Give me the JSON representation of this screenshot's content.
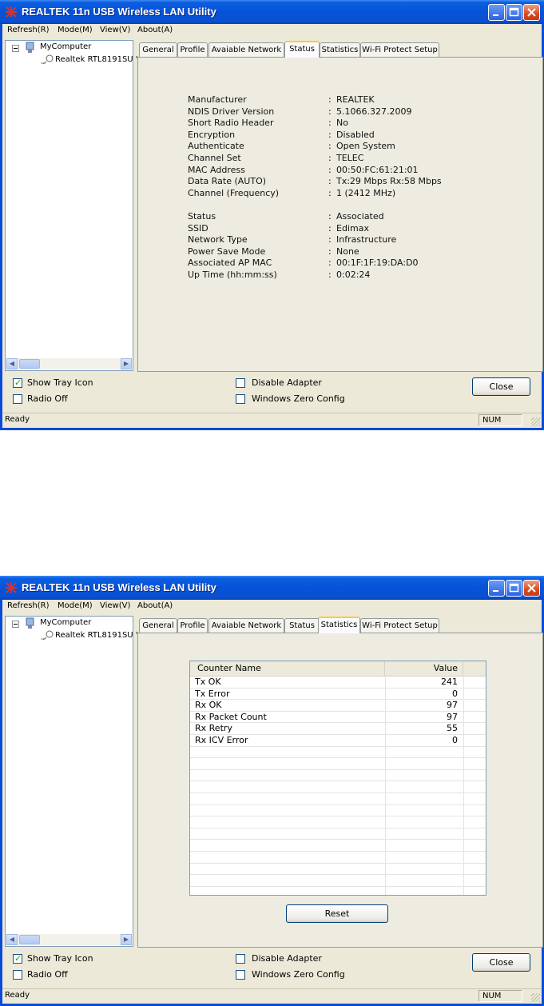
{
  "window1": {
    "title": "REALTEK 11n USB Wireless LAN Utility",
    "menu": [
      "Refresh(R)",
      "Mode(M)",
      "View(V)",
      "About(A)"
    ],
    "tree": {
      "root": "MyComputer",
      "child": "Realtek RTL8191SU '"
    },
    "tabs": [
      "General",
      "Profile",
      "Avaiable Network",
      "Status",
      "Statistics",
      "Wi-Fi Protect Setup"
    ],
    "active_tab": "Status",
    "status_fields": [
      {
        "label": "Manufacturer",
        "value": "REALTEK"
      },
      {
        "label": "NDIS Driver Version",
        "value": "5.1066.327.2009"
      },
      {
        "label": "Short Radio Header",
        "value": "No"
      },
      {
        "label": "Encryption",
        "value": "Disabled"
      },
      {
        "label": "Authenticate",
        "value": "Open System"
      },
      {
        "label": "Channel Set",
        "value": "TELEC"
      },
      {
        "label": "MAC Address",
        "value": "00:50:FC:61:21:01"
      },
      {
        "label": "Data Rate (AUTO)",
        "value": "Tx:29 Mbps Rx:58 Mbps"
      },
      {
        "label": "Channel (Frequency)",
        "value": "1 (2412 MHz)"
      },
      {
        "label": "Status",
        "value": "Associated"
      },
      {
        "label": "SSID",
        "value": "Edimax"
      },
      {
        "label": "Network Type",
        "value": "Infrastructure"
      },
      {
        "label": "Power Save Mode",
        "value": "None"
      },
      {
        "label": "Associated AP MAC",
        "value": "00:1F:1F:19:DA:D0"
      },
      {
        "label": "Up Time (hh:mm:ss)",
        "value": "0:02:24"
      }
    ],
    "separator": ":",
    "bottom": {
      "show_tray_icon": {
        "label": "Show Tray Icon",
        "checked": true
      },
      "radio_off": {
        "label": "Radio Off",
        "checked": false
      },
      "disable_adapter": {
        "label": "Disable Adapter",
        "checked": false
      },
      "windows_zero_config": {
        "label": "Windows Zero Config",
        "checked": false
      },
      "close_label": "Close"
    },
    "statusbar": {
      "text": "Ready",
      "num": "NUM"
    }
  },
  "window2": {
    "title": "REALTEK 11n USB Wireless LAN Utility",
    "menu": [
      "Refresh(R)",
      "Mode(M)",
      "View(V)",
      "About(A)"
    ],
    "tree": {
      "root": "MyComputer",
      "child": "Realtek RTL8191SU '"
    },
    "tabs": [
      "General",
      "Profile",
      "Avaiable Network",
      "Status",
      "Statistics",
      "Wi-Fi Protect Setup"
    ],
    "active_tab": "Statistics",
    "statistics": {
      "headers": [
        "Counter Name",
        "Value"
      ],
      "rows": [
        {
          "name": "Tx OK",
          "value": "241"
        },
        {
          "name": "Tx Error",
          "value": "0"
        },
        {
          "name": "Rx OK",
          "value": "97"
        },
        {
          "name": "Rx Packet Count",
          "value": "97"
        },
        {
          "name": "Rx Retry",
          "value": "55"
        },
        {
          "name": "Rx ICV Error",
          "value": "0"
        }
      ],
      "reset_label": "Reset"
    },
    "bottom": {
      "show_tray_icon": {
        "label": "Show Tray Icon",
        "checked": true
      },
      "radio_off": {
        "label": "Radio Off",
        "checked": false
      },
      "disable_adapter": {
        "label": "Disable Adapter",
        "checked": false
      },
      "windows_zero_config": {
        "label": "Windows Zero Config",
        "checked": false
      },
      "close_label": "Close"
    },
    "statusbar": {
      "text": "Ready",
      "num": "NUM"
    }
  },
  "colors": {
    "titlebar": "#0653d8",
    "active_tab_accent": "#ffc83c",
    "check": "#21a121"
  }
}
